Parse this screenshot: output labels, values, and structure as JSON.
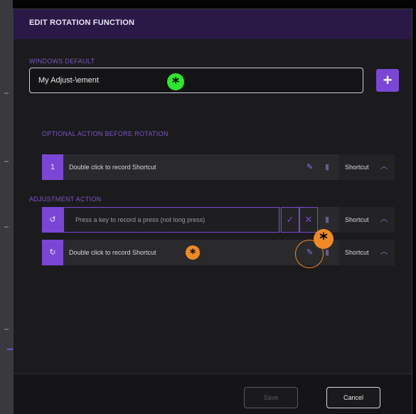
{
  "dialog": {
    "title": "EDIT ROTATION FUNCTION",
    "windows_default_label": "WINDOWS DEFAULT",
    "name_value": "My Adjust-\\ement",
    "add_label": "+",
    "optional_action_label": "OPTIONAL ACTION BEFORE ROTATION",
    "adjustment_action_label": "ADJUSTMENT ACTION"
  },
  "optional_row": {
    "number": "1",
    "label": "Double click to record Shortcut",
    "shortcut": "Shortcut"
  },
  "adjustment_rows": [
    {
      "icon": "rotate-ccw-icon",
      "record_prompt": "Press a key to record a press (not long press)",
      "shortcut": "Shortcut"
    },
    {
      "icon": "rotate-cw-icon",
      "label": "Double click to record Shortcut",
      "shortcut": "Shortcut"
    }
  ],
  "footer": {
    "save_label": "Save",
    "cancel_label": "Cancel"
  },
  "annotations": {
    "marker_symbol": "*",
    "green": "#2ee62e",
    "orange": "#f08a24"
  }
}
